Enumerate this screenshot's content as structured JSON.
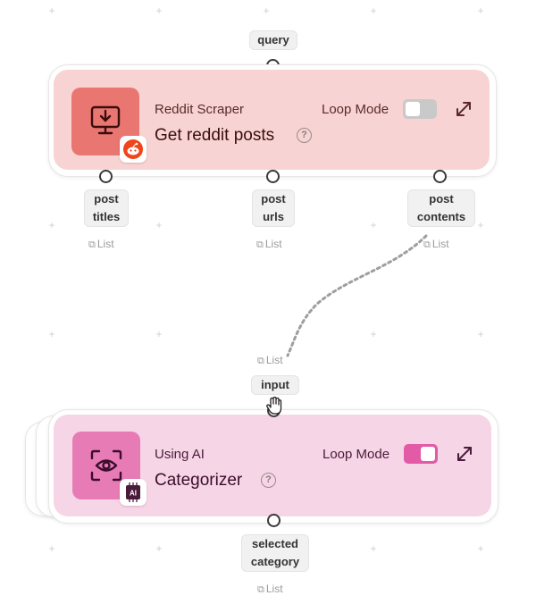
{
  "input_port_label_top": "query",
  "reddit_node": {
    "subtitle": "Reddit Scraper",
    "title": "Get reddit posts",
    "help": "?",
    "loop_mode_label": "Loop Mode",
    "loop_mode_on": false,
    "icon": "download-monitor-icon",
    "badge_icon": "reddit-icon",
    "accent_color": "#e97670",
    "outputs": [
      {
        "line1": "post",
        "line2": "titles",
        "type": "List"
      },
      {
        "line1": "post",
        "line2": "urls",
        "type": "List"
      },
      {
        "line1": "post",
        "line2": "contents",
        "type": "List"
      }
    ]
  },
  "connection": {
    "from": "post contents",
    "to": "input",
    "type_label": "List"
  },
  "categorizer_node": {
    "input_label": "input",
    "subtitle": "Using AI",
    "title": "Categorizer",
    "help": "?",
    "loop_mode_label": "Loop Mode",
    "loop_mode_on": true,
    "icon": "scan-eye-icon",
    "badge_icon": "ai-chip-icon",
    "badge_text": "AI",
    "accent_color": "#e77bb6",
    "outputs": [
      {
        "line1": "selected",
        "line2": "category",
        "type": "List"
      }
    ]
  }
}
